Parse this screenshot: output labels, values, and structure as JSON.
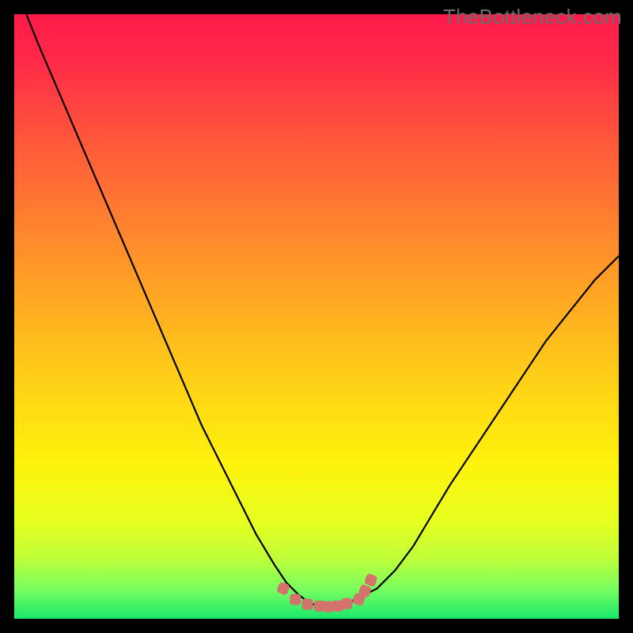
{
  "watermark": "TheBottleneck.com",
  "chart_data": {
    "type": "line",
    "title": "",
    "xlabel": "",
    "ylabel": "",
    "xlim": [
      0,
      100
    ],
    "ylim": [
      0,
      100
    ],
    "grid": false,
    "legend": false,
    "gradient_stops": [
      {
        "offset": 0.0,
        "color": "#ff1a4b"
      },
      {
        "offset": 0.08,
        "color": "#ff2b47"
      },
      {
        "offset": 0.2,
        "color": "#ff553b"
      },
      {
        "offset": 0.34,
        "color": "#ff802f"
      },
      {
        "offset": 0.48,
        "color": "#ffab22"
      },
      {
        "offset": 0.62,
        "color": "#ffd416"
      },
      {
        "offset": 0.74,
        "color": "#fff20c"
      },
      {
        "offset": 0.84,
        "color": "#e6ff1f"
      },
      {
        "offset": 0.9,
        "color": "#bfff3a"
      },
      {
        "offset": 0.95,
        "color": "#7aff5e"
      },
      {
        "offset": 1.0,
        "color": "#19e86b"
      }
    ],
    "series": [
      {
        "name": "bottleneck-curve",
        "color": "#000000",
        "x": [
          2,
          4,
          7,
          10,
          13,
          16,
          19,
          22,
          25,
          28,
          31,
          34,
          37,
          40,
          43,
          45,
          47,
          49,
          51,
          53,
          55,
          57,
          60,
          63,
          66,
          69,
          72,
          76,
          80,
          84,
          88,
          92,
          96,
          100
        ],
        "y": [
          100,
          95,
          88,
          81,
          74,
          67,
          60,
          53,
          46,
          39,
          32,
          26,
          20,
          14,
          9,
          6,
          4,
          2.5,
          2,
          2,
          2.5,
          3.5,
          5,
          8,
          12,
          17,
          22,
          28,
          34,
          40,
          46,
          51,
          56,
          60
        ]
      }
    ],
    "markers": {
      "name": "flat-region-markers",
      "color": "#d4736c",
      "points": [
        {
          "x": 44.5,
          "y": 5.0,
          "shape": "square-tilt"
        },
        {
          "x": 46.5,
          "y": 3.2,
          "shape": "square"
        },
        {
          "x": 48.5,
          "y": 2.4,
          "shape": "square"
        },
        {
          "x": 50.5,
          "y": 2.1,
          "shape": "square"
        },
        {
          "x": 52.0,
          "y": 2.0,
          "shape": "square"
        },
        {
          "x": 53.5,
          "y": 2.1,
          "shape": "square"
        },
        {
          "x": 55.0,
          "y": 2.5,
          "shape": "square"
        },
        {
          "x": 57.0,
          "y": 3.2,
          "shape": "square-tilt"
        },
        {
          "x": 58.0,
          "y": 4.6,
          "shape": "square-tilt"
        },
        {
          "x": 59.0,
          "y": 6.4,
          "shape": "square-tilt"
        }
      ]
    }
  }
}
